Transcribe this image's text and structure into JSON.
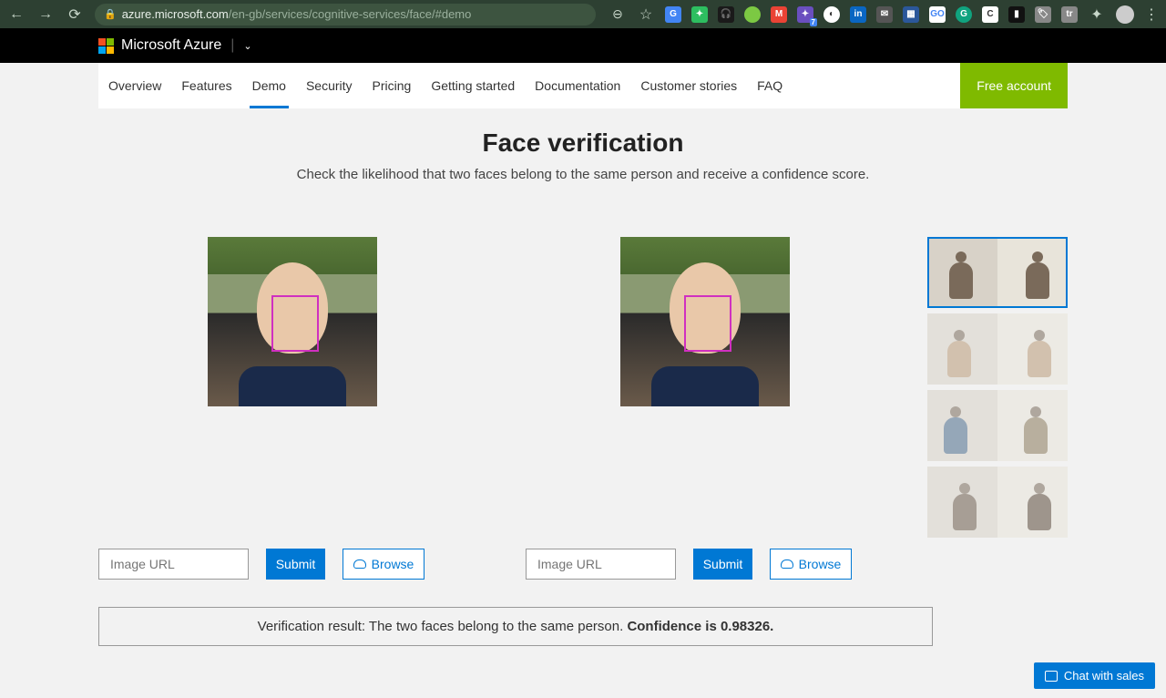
{
  "browser": {
    "url_host": "azure.microsoft.com",
    "url_path": "/en-gb/services/cognitive-services/face/#demo"
  },
  "header": {
    "brand": "Microsoft Azure"
  },
  "nav": {
    "items": [
      "Overview",
      "Features",
      "Demo",
      "Security",
      "Pricing",
      "Getting started",
      "Documentation",
      "Customer stories",
      "FAQ"
    ],
    "active_index": 2,
    "cta": "Free account"
  },
  "page": {
    "title": "Face verification",
    "subtitle": "Check the likelihood that two faces belong to the same person and receive a confidence score."
  },
  "inputs": {
    "placeholder": "Image URL",
    "submit": "Submit",
    "browse": "Browse"
  },
  "result": {
    "prefix": "Verification result: The two faces belong to the same person. ",
    "confidence_label": "Confidence is 0.98326."
  },
  "chat": {
    "label": "Chat with sales"
  },
  "ext_badge": "7"
}
